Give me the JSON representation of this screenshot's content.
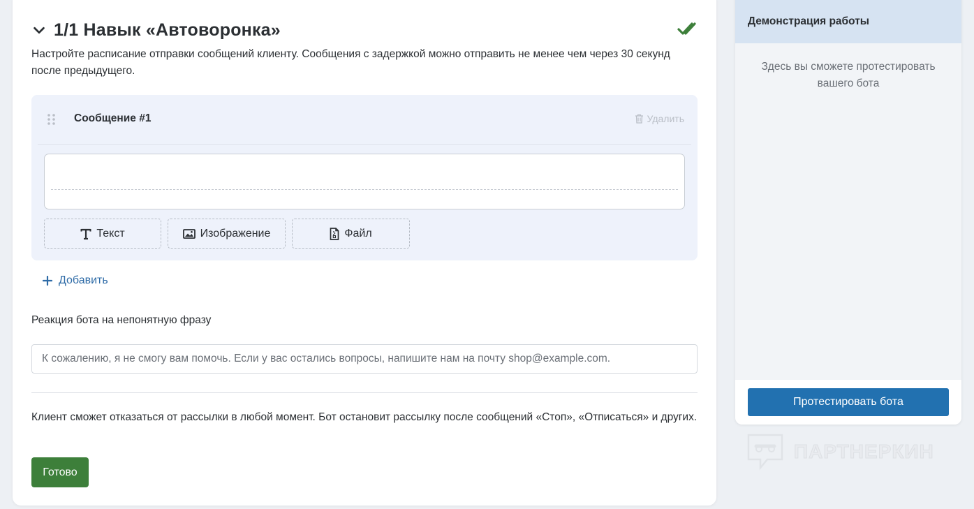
{
  "skill": {
    "title": "1/1 Навык «Автоворонка»",
    "description": "Настройте расписание отправки сообщений клиенту. Сообщения с задержкой можно отправить не менее чем через 30 секунд после предыдущего."
  },
  "message": {
    "title": "Сообщение #1",
    "delete_label": "Удалить",
    "buttons": {
      "text": "Текст",
      "image": "Изображение",
      "file": "Файл"
    }
  },
  "add_label": "Добавить",
  "reaction": {
    "label": "Реакция бота на непонятную фразу",
    "placeholder": "К сожалению, я не смогу вам помочь. Если у вас остались вопросы, напишите нам на почту shop@example.com."
  },
  "note": "Клиент сможет отказаться от рассылки в любой момент. Бот остановит рассылку после сообщений «Стоп», «Отписаться» и других.",
  "done_label": "Готово",
  "demo": {
    "title": "Демонстрация работы",
    "body": "Здесь вы сможете протестировать вашего бота",
    "test_label": "Протестировать бота"
  },
  "watermark": "ПАРТНЕРКИН",
  "colors": {
    "accent_green": "#3d7f3a",
    "accent_blue": "#2271b0",
    "link_blue": "#2e6ba7",
    "check_green": "#3d7f3a"
  }
}
